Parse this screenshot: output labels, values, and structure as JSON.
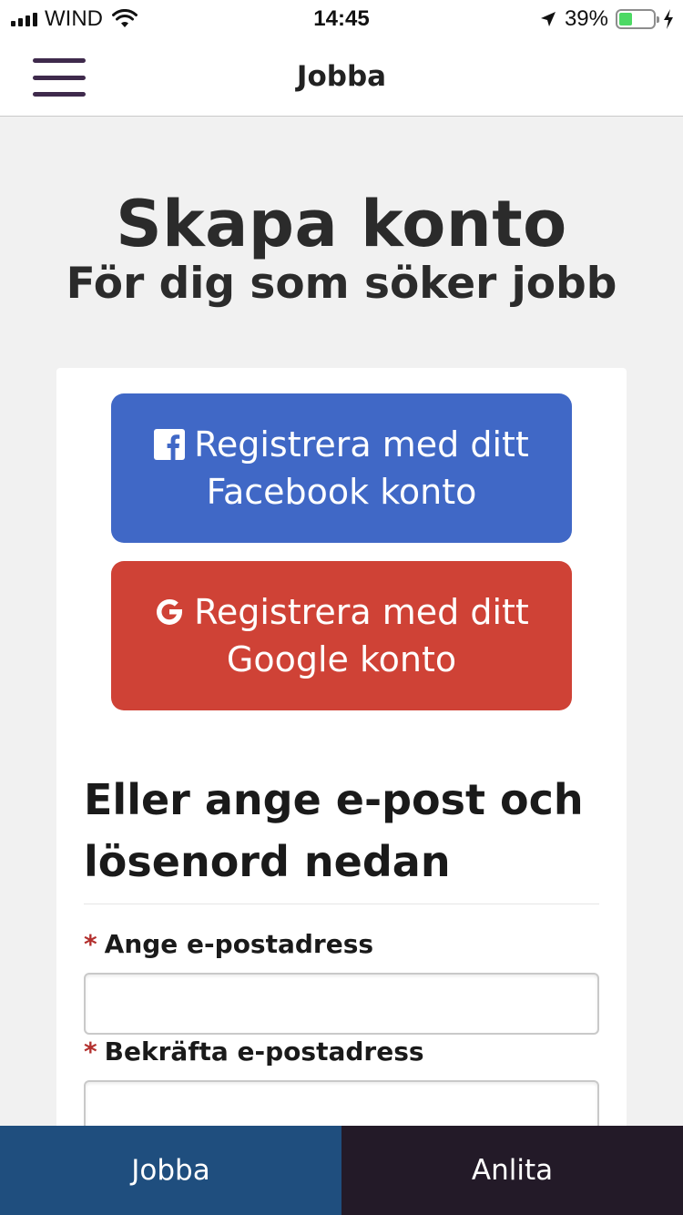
{
  "status_bar": {
    "carrier": "WIND",
    "time": "14:45",
    "battery_percent": "39%",
    "battery_level": 0.39
  },
  "header": {
    "title": "Jobba",
    "menu_icon": "hamburger-menu-icon"
  },
  "page": {
    "title": "Skapa konto",
    "subtitle": "För dig som söker jobb"
  },
  "social": {
    "facebook": {
      "label": "Registrera med ditt Facebook konto",
      "icon": "facebook-icon",
      "color": "#4068c6"
    },
    "google": {
      "label": "Registrera med ditt Google konto",
      "icon": "google-icon",
      "color": "#cf4236"
    }
  },
  "form": {
    "heading": "Eller ange e-post och lösenord nedan",
    "required_marker": "*",
    "email_label": "Ange e-postadress",
    "email_value": "",
    "confirm_label": "Bekräfta e-postadress",
    "confirm_value": ""
  },
  "tabs": [
    {
      "label": "Jobba",
      "color": "#1f4e7e",
      "active": true
    },
    {
      "label": "Anlita",
      "color": "#231a28",
      "active": false
    }
  ]
}
